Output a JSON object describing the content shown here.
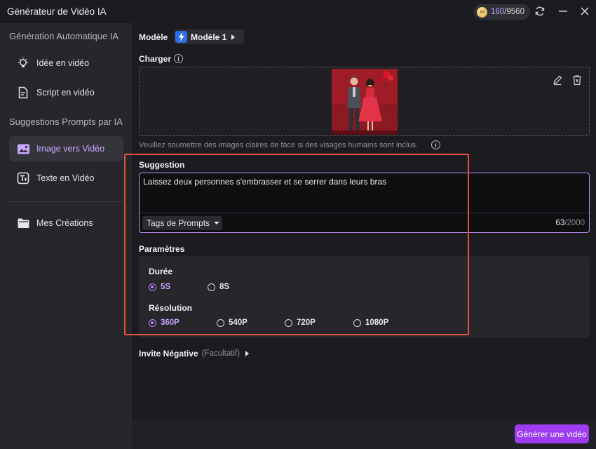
{
  "window": {
    "title": "Générateur de Vidéo IA",
    "credits_used": "160",
    "credits_total": "/9560",
    "credits_icon": "coin-icon",
    "accent_color": "#b884f7"
  },
  "sidebar": {
    "section1": "Génération Automatique IA",
    "section2": "Suggestions Prompts par IA",
    "items": [
      {
        "label": "Idée en vidéo",
        "icon": "lightbulb-icon"
      },
      {
        "label": "Script en vidéo",
        "icon": "document-icon"
      },
      {
        "label": "Image vers Vidéo",
        "icon": "image-icon",
        "active": true
      },
      {
        "label": "Texte en Vidéo",
        "icon": "text-icon"
      },
      {
        "label": "Mes Créations",
        "icon": "folder-icon"
      }
    ]
  },
  "model": {
    "label": "Modèle",
    "value": "Modèle 1"
  },
  "upload": {
    "label": "Charger",
    "hint": "Veuillez soumettre des images claires de face si des visages humains sont inclus."
  },
  "prompt": {
    "label": "Suggestion",
    "text": "Laissez deux personnes s'embrasser et se serrer dans leurs bras",
    "tags_label": "Tags de Prompts",
    "count": "63",
    "max": "/2000"
  },
  "params": {
    "label": "Paramètres",
    "duration_label": "Durée",
    "durations": [
      "5S",
      "8S"
    ],
    "duration_selected": "5S",
    "resolution_label": "Résolution",
    "resolutions": [
      "360P",
      "540P",
      "720P",
      "1080P"
    ],
    "resolution_selected": "360P"
  },
  "negative": {
    "label": "Invite Négative",
    "optional": "(Facultatif)"
  },
  "footer": {
    "generate_label": "Générer une vidéo"
  }
}
